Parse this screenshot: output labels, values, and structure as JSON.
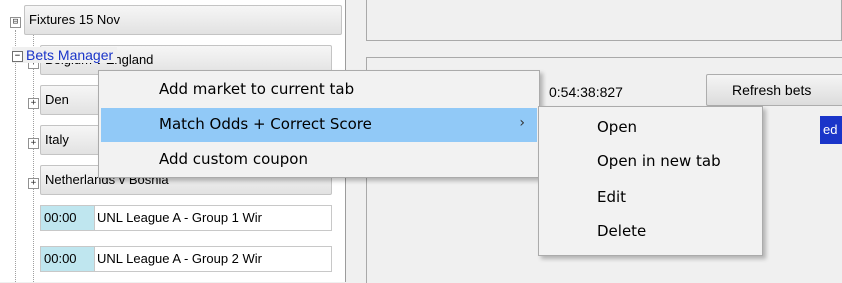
{
  "tree": {
    "root": {
      "expander": "⊟",
      "label": "Fixtures 15 Nov"
    },
    "matches": [
      {
        "expander": "+",
        "label": "Belgium v England"
      },
      {
        "expander": "+",
        "label": "Den"
      },
      {
        "expander": "+",
        "label": "Italy"
      },
      {
        "expander": "+",
        "label": "Netherlands v Bosnia"
      }
    ],
    "fixtures": [
      {
        "time": "00:00",
        "name": "UNL League A - Group 1 Wir"
      },
      {
        "time": "00:00",
        "name": "UNL League A - Group 2 Wir"
      }
    ]
  },
  "bets_manager": {
    "collapse_glyph": "−",
    "title": "Bets Manager",
    "time": "0:54:38:827",
    "refresh_label": "Refresh bets",
    "blue_tab_text": "ed"
  },
  "context_menu": {
    "items": [
      {
        "label": "Add market to current tab"
      },
      {
        "label": "Match Odds + Correct Score",
        "arrow": "›"
      },
      {
        "label": "Add custom coupon"
      }
    ]
  },
  "submenu": {
    "items": [
      {
        "label": "Open"
      },
      {
        "label": "Open in new tab"
      },
      {
        "label": "Edit"
      },
      {
        "label": "Delete"
      }
    ]
  },
  "colors": {
    "highlight": "#91c9f7",
    "accent_blue": "#1a35c9",
    "fixture_time_bg": "#bfe6ef"
  }
}
